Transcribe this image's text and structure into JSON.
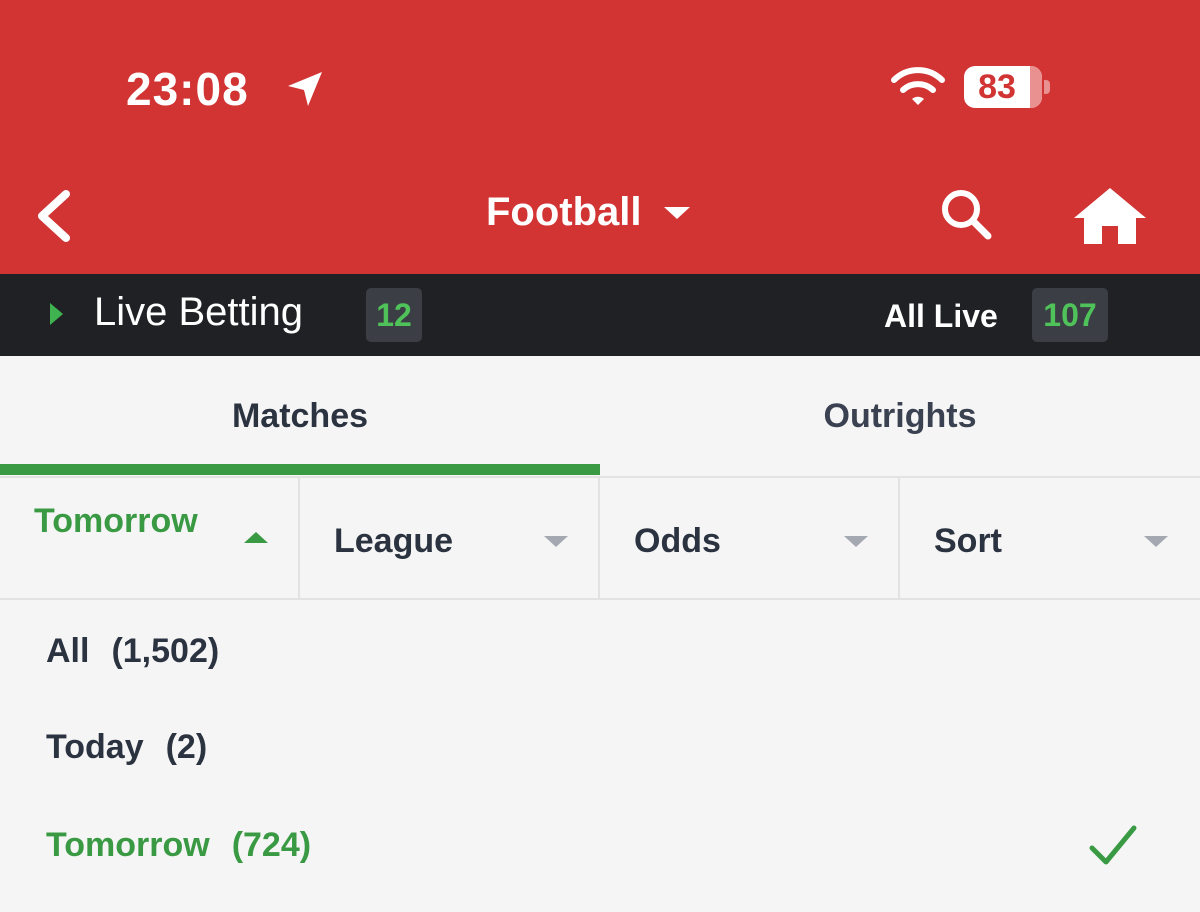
{
  "status_bar": {
    "time": "23:08",
    "battery": "83"
  },
  "header": {
    "title": "Football"
  },
  "live_bar": {
    "label": "Live Betting",
    "live_count": "12",
    "all_live_label": "All Live",
    "all_live_count": "107"
  },
  "tabs": [
    {
      "label": "Matches",
      "active": true
    },
    {
      "label": "Outrights",
      "active": false
    }
  ],
  "filters": [
    {
      "label": "Tomorrow",
      "open": true
    },
    {
      "label": "League"
    },
    {
      "label": "Odds"
    },
    {
      "label": "Sort"
    }
  ],
  "date_options": [
    {
      "label": "All",
      "count": "(1,502)"
    },
    {
      "label": "Today",
      "count": "(2)"
    },
    {
      "label": "Tomorrow",
      "count": "(724)",
      "selected": true
    }
  ],
  "colors": {
    "header": "#d23333",
    "live_bar": "#1f2125",
    "accent_green": "#3a9a44"
  },
  "icons": [
    "location-arrow-icon",
    "wifi-icon",
    "back-chevron-icon",
    "search-icon",
    "home-icon",
    "checkmark-icon"
  ]
}
